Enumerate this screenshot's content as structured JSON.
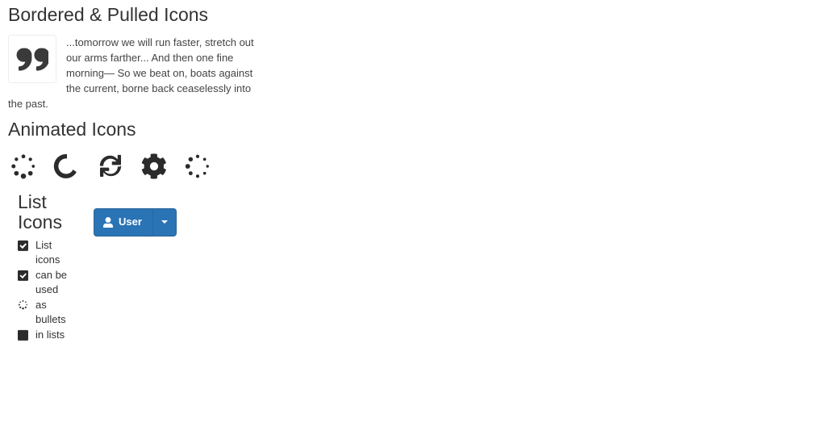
{
  "sections": {
    "bordered": {
      "heading": "Bordered & Pulled Icons",
      "icon": "quote-left-icon",
      "quote": "...tomorrow we will run faster, stretch out our arms farther... And then one fine morning— So we beat on, boats against the current, borne back ceaselessly into the past."
    },
    "animated": {
      "heading": "Animated Icons",
      "icons": [
        {
          "name": "spinner-icon",
          "animation": "spin"
        },
        {
          "name": "circle-notch-icon",
          "animation": "spin"
        },
        {
          "name": "sync-icon",
          "animation": "spin"
        },
        {
          "name": "cog-icon",
          "animation": "spin"
        },
        {
          "name": "spinner-pulse-icon",
          "animation": "pulse"
        }
      ]
    },
    "list": {
      "heading": "List Icons",
      "items": [
        {
          "icon": "check-square-icon",
          "label": "List icons"
        },
        {
          "icon": "check-square-icon",
          "label": "can be used"
        },
        {
          "icon": "spinner-icon",
          "label": "as bullets"
        },
        {
          "icon": "square-icon",
          "label": "in lists"
        }
      ]
    },
    "button": {
      "icon": "user-icon",
      "label": "User",
      "toggle_icon": "caret-down-icon",
      "color": "#2a74b5",
      "border_color": "#2a6496",
      "text_color": "#ffffff"
    }
  }
}
